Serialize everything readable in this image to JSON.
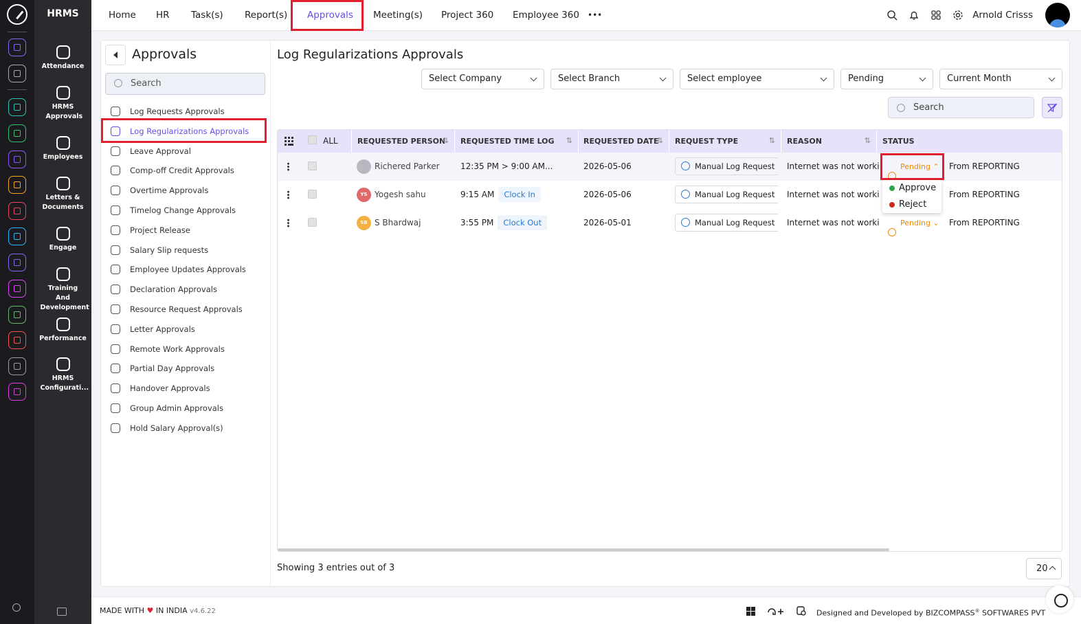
{
  "app": {
    "brand": "HRMS"
  },
  "rail": {
    "icons": [
      {
        "name": "home-app-icon",
        "color": "#7c6cf0"
      },
      {
        "name": "pin-app-icon",
        "color": "#aaaaaa"
      },
      {
        "name": "people-app-icon",
        "color": "#2ec4b6"
      },
      {
        "name": "hrms-app-icon",
        "color": "#36c26a"
      },
      {
        "name": "briefcase-app-icon",
        "color": "#8d5cf6"
      },
      {
        "name": "grid-app-icon",
        "color": "#f5a623"
      },
      {
        "name": "target-app-icon",
        "color": "#e94560"
      },
      {
        "name": "doc-app-icon",
        "color": "#29b6f6"
      },
      {
        "name": "flow-app-icon",
        "color": "#7c6cf0"
      },
      {
        "name": "monitor-app-icon",
        "color": "#e040fb"
      },
      {
        "name": "file-app-icon",
        "color": "#66bb6a"
      },
      {
        "name": "user-app-icon",
        "color": "#ef5350"
      },
      {
        "name": "house-app-icon",
        "color": "#9e9e9e"
      },
      {
        "name": "settings-app-icon",
        "color": "#d63fdc"
      }
    ]
  },
  "dock": {
    "items": [
      {
        "label": "Attendance"
      },
      {
        "label": "HRMS Approvals"
      },
      {
        "label": "Employees"
      },
      {
        "label": "Letters & Documents"
      },
      {
        "label": "Engage"
      },
      {
        "label": "Training And Development"
      },
      {
        "label": "Performance"
      },
      {
        "label": "HRMS Configurati..."
      }
    ]
  },
  "topnav": {
    "items": [
      "Home",
      "HR",
      "Task(s)",
      "Report(s)",
      "Approvals",
      "Meeting(s)",
      "Project 360",
      "Employee 360"
    ],
    "active": "Approvals",
    "more": "•••",
    "user": "Arnold Crisss"
  },
  "left": {
    "title": "Approvals",
    "search_placeholder": "Search",
    "items": [
      "Log Requests Approvals",
      "Log Regularizations Approvals",
      "Leave Approval",
      "Comp-off Credit Approvals",
      "Overtime Approvals",
      "Timelog Change Approvals",
      "Project Release",
      "Salary Slip requests",
      "Employee Updates Approvals",
      "Declaration Approvals",
      "Resource Request Approvals",
      "Letter Approvals",
      "Remote Work Approvals",
      "Partial Day Approvals",
      "Handover Approvals",
      "Group Admin Approvals",
      "Hold Salary Approval(s)"
    ],
    "active": "Log Regularizations Approvals"
  },
  "page": {
    "title": "Log Regularizations Approvals",
    "filters": [
      "Select Company",
      "Select Branch",
      "Select employee",
      "Pending",
      "Current Month"
    ],
    "search_placeholder": "Search"
  },
  "table": {
    "all_label": "ALL",
    "headers": [
      "REQUESTED PERSON",
      "REQUESTED TIME LOG",
      "REQUESTED DATE",
      "REQUEST TYPE",
      "REASON",
      "STATUS"
    ],
    "rows": [
      {
        "person": "Richered Parker",
        "initials": "",
        "avatar_color": "#b8b8c0",
        "time": "12:35 PM > 9:00 AM...",
        "clock": "",
        "date": "2026-05-06",
        "type": "Manual Log Request",
        "reason": "Internet was not working",
        "status": "Pending",
        "from": "From REPORTING"
      },
      {
        "person": "Yogesh sahu",
        "initials": "YS",
        "avatar_color": "#e06a6a",
        "time": "9:15 AM",
        "clock": "Clock In",
        "date": "2026-05-06",
        "type": "Manual Log Request",
        "reason": "Internet was not working",
        "status": "",
        "from": "From REPORTING"
      },
      {
        "person": "S Bhardwaj",
        "initials": "SB",
        "avatar_color": "#f5b041",
        "time": "3:55 PM",
        "clock": "Clock Out",
        "date": "2026-05-01",
        "type": "Manual Log Request",
        "reason": "Internet was not working",
        "status": "Pending",
        "from": "From REPORTING"
      }
    ],
    "status_menu": [
      {
        "label": "Approve",
        "color": "#2ea44f"
      },
      {
        "label": "Reject",
        "color": "#d0281e"
      }
    ],
    "showing": "Showing 3 entries out of 3",
    "page_size": "20"
  },
  "footer": {
    "made_with": "MADE WITH",
    "made_in": "IN INDIA",
    "version": "v4.6.22",
    "designed": "Designed and Developed by",
    "company": "BIZCOMPASS",
    "reg": "®",
    "company_suffix": "SOFTWARES PVT"
  },
  "colors": {
    "accent": "#6b4ce6",
    "highlight": "#e0202e",
    "pending": "#f08a00",
    "heart": "#e0202e"
  }
}
